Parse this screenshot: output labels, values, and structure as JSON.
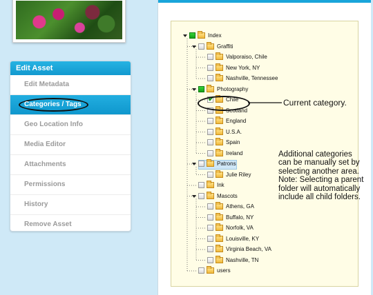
{
  "sidebar": {
    "header": "Edit Asset",
    "items": [
      {
        "label": "Edit Metadata",
        "active": false
      },
      {
        "label": "Categories / Tags",
        "active": true
      },
      {
        "label": "Geo Location Info",
        "active": false
      },
      {
        "label": "Media Editor",
        "active": false
      },
      {
        "label": "Attachments",
        "active": false
      },
      {
        "label": "Permissions",
        "active": false
      },
      {
        "label": "History",
        "active": false
      },
      {
        "label": "Remove Asset",
        "active": false
      }
    ]
  },
  "tree": {
    "nodes": [
      {
        "label": "Index",
        "level": 0,
        "expandable": true,
        "checkbox": "green"
      },
      {
        "label": "Graffiti",
        "level": 1,
        "expandable": true,
        "checkbox": "empty"
      },
      {
        "label": "Valporaiso, Chile",
        "level": 2,
        "expandable": false,
        "checkbox": "empty"
      },
      {
        "label": "New York, NY",
        "level": 2,
        "expandable": false,
        "checkbox": "empty"
      },
      {
        "label": "Nashville, Tennessee",
        "level": 2,
        "expandable": false,
        "checkbox": "empty"
      },
      {
        "label": "Photography",
        "level": 1,
        "expandable": true,
        "checkbox": "green"
      },
      {
        "label": "Chile",
        "level": 2,
        "expandable": false,
        "checkbox": "checked"
      },
      {
        "label": "Scotland",
        "level": 2,
        "expandable": false,
        "checkbox": "empty"
      },
      {
        "label": "England",
        "level": 2,
        "expandable": false,
        "checkbox": "empty"
      },
      {
        "label": "U.S.A.",
        "level": 2,
        "expandable": false,
        "checkbox": "empty"
      },
      {
        "label": "Spain",
        "level": 2,
        "expandable": false,
        "checkbox": "empty"
      },
      {
        "label": "Ireland",
        "level": 2,
        "expandable": false,
        "checkbox": "empty"
      },
      {
        "label": "Patrons",
        "level": 1,
        "expandable": true,
        "checkbox": "empty",
        "highlighted": true
      },
      {
        "label": "Julie Riley",
        "level": 2,
        "expandable": false,
        "checkbox": "empty"
      },
      {
        "label": "Ink",
        "level": 1,
        "expandable": false,
        "checkbox": "empty"
      },
      {
        "label": "Mascots",
        "level": 1,
        "expandable": true,
        "checkbox": "empty"
      },
      {
        "label": "Athens, GA",
        "level": 2,
        "expandable": false,
        "checkbox": "empty"
      },
      {
        "label": "Buffalo, NY",
        "level": 2,
        "expandable": false,
        "checkbox": "empty"
      },
      {
        "label": "Norfolk, VA",
        "level": 2,
        "expandable": false,
        "checkbox": "empty"
      },
      {
        "label": "Louisville, KY",
        "level": 2,
        "expandable": false,
        "checkbox": "empty"
      },
      {
        "label": "Virginia Beach, VA",
        "level": 2,
        "expandable": false,
        "checkbox": "empty"
      },
      {
        "label": "Nashville, TN",
        "level": 2,
        "expandable": false,
        "checkbox": "empty"
      },
      {
        "label": "users",
        "level": 1,
        "expandable": false,
        "checkbox": "empty"
      }
    ]
  },
  "annotations": {
    "current_category": "Current category.",
    "additional_note": "Additional categories can be manually set by selecting another area. Note: Selecting a parent folder will automatically include all child folders."
  },
  "colors": {
    "accent": "#1aa5da",
    "background": "#cfe9f7",
    "tree_background": "#fffde6",
    "checked_green": "#15a018"
  },
  "icons": {
    "tree_expander": "triangle-down-icon",
    "tree_folder": "folder-icon",
    "tree_checkbox": "checkbox-icon",
    "checkmark": "checkmark-icon"
  }
}
